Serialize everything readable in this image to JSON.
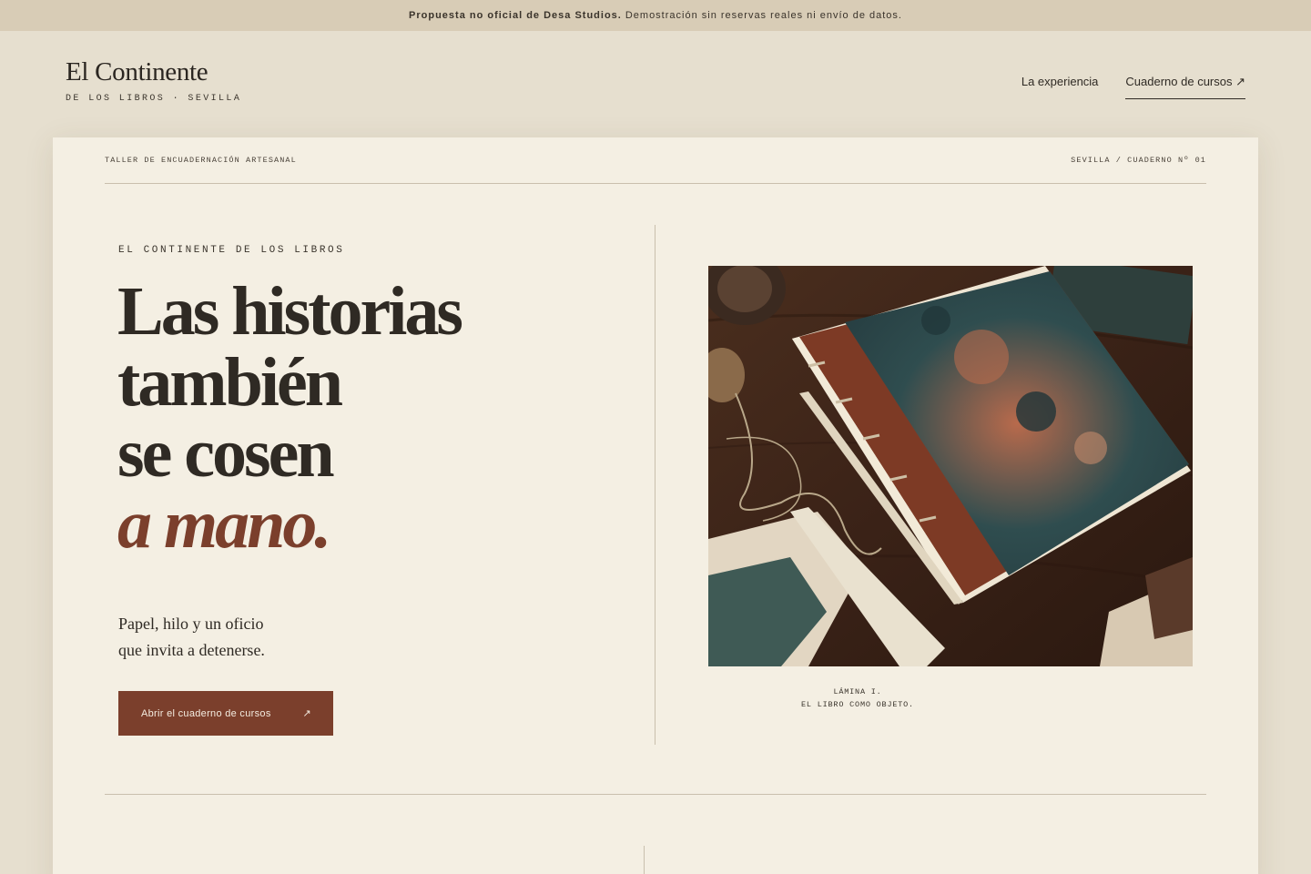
{
  "banner": {
    "bold": "Propuesta no oficial de Desa Studios.",
    "text": "Demostración sin reservas reales ni envío de datos."
  },
  "brand": {
    "name": "El Continente",
    "subtitle": "DE LOS LIBROS · SEVILLA"
  },
  "nav": {
    "items": [
      {
        "label": "La experiencia"
      },
      {
        "label": "Cuaderno de cursos ↗"
      }
    ]
  },
  "hero": {
    "meta_left": "TALLER DE ENCUADERNACIÓN ARTESANAL",
    "meta_right": "SEVILLA / CUADERNO Nº 01",
    "eyebrow": "EL CONTINENTE DE LOS LIBROS",
    "headline": [
      "Las historias",
      "también",
      "se cosen"
    ],
    "headline_accent": "a mano.",
    "lead": [
      "Papel, hilo y un oficio",
      "que invita a detenerse."
    ],
    "cta_label": "Abrir el cuaderno de cursos",
    "cta_icon": "↗",
    "caption": [
      "LÁMINA I.",
      "EL LIBRO COMO OBJETO."
    ]
  },
  "colors": {
    "page_bg": "#e6dfcf",
    "card_bg": "#f4efe3",
    "accent": "#7b3f2c",
    "text": "#2f2a24"
  }
}
